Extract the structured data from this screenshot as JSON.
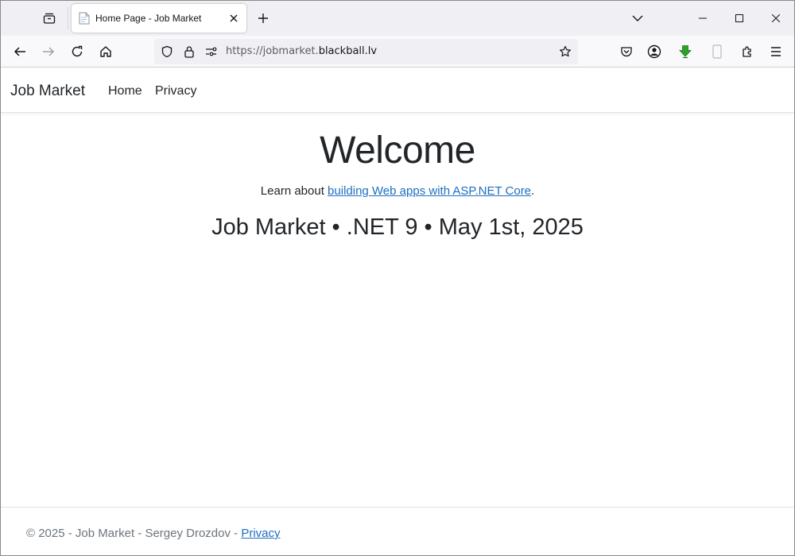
{
  "browser": {
    "tab": {
      "title": "Home Page - Job Market",
      "favicon": "page-icon"
    },
    "url": {
      "prefix": "https://jobmarket.",
      "domain": "blackball.lv"
    },
    "icons": {
      "tab_list": "tab-list-icon",
      "close": "close-icon",
      "new_tab": "plus-icon",
      "back": "back-arrow-icon",
      "forward": "forward-arrow-icon",
      "reload": "reload-icon",
      "home": "home-icon",
      "shield": "shield-icon",
      "lock": "lock-icon",
      "permissions": "permissions-icon",
      "bookmark": "star-icon",
      "pocket": "pocket-icon",
      "account": "account-icon",
      "download_ext": "download-extension-icon",
      "device": "device-icon",
      "extensions": "extensions-icon",
      "menu": "hamburger-menu-icon"
    },
    "colors": {
      "tabstrip": "#f0f0f4",
      "toolbar": "#f9f9fb",
      "urlbar": "#f0f0f4",
      "extension_green": "#2aa22a"
    }
  },
  "site": {
    "brand": "Job Market",
    "nav": {
      "home": "Home",
      "privacy": "Privacy"
    },
    "main": {
      "heading": "Welcome",
      "learn_prefix": "Learn about ",
      "learn_link": "building Web apps with ASP.NET Core",
      "learn_suffix": ".",
      "subtitle": "Job Market • .NET 9 • May 1st, 2025"
    },
    "footer": {
      "text": "© 2025 - Job Market - Sergey Drozdov - ",
      "link": "Privacy"
    },
    "colors": {
      "link": "#1b6ec2",
      "text": "#212529",
      "muted": "#6c757d"
    }
  }
}
